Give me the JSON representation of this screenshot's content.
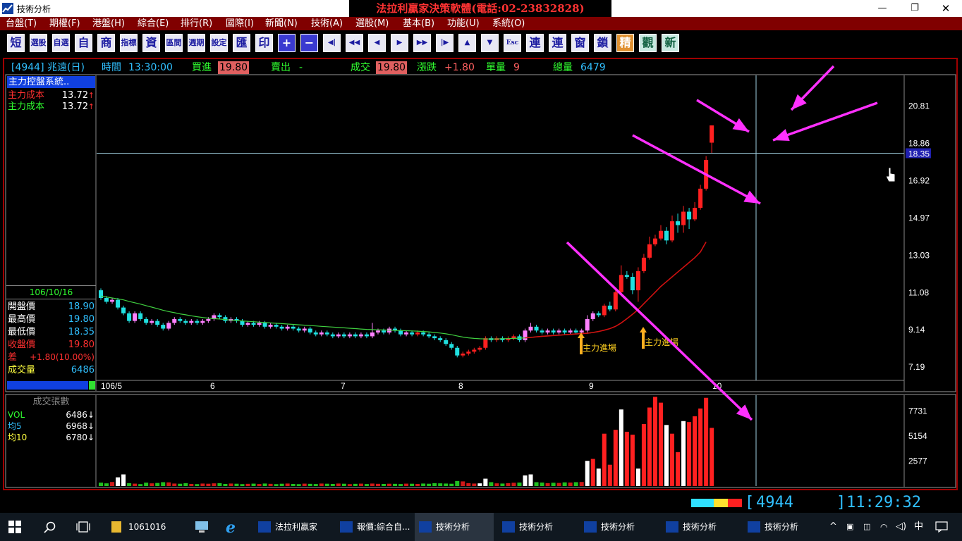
{
  "window": {
    "title": "技術分析",
    "brand": "法拉利贏家決策軟體(電話:02-23832828)"
  },
  "menu": [
    "台盤(T)",
    "期權(F)",
    "港盤(H)",
    "綜合(E)",
    "排行(R)",
    "國際(I)",
    "新聞(N)",
    "技術(A)",
    "選股(M)",
    "基本(B)",
    "功能(U)",
    "系統(O)"
  ],
  "toolbar": [
    "短",
    "選股",
    "自選",
    "自",
    "商",
    "指標",
    "資",
    "區間",
    "週期",
    "設定",
    "匯",
    "印",
    "+",
    "−",
    "◀|",
    "◀◀",
    "◀",
    "▶",
    "▶▶",
    "|▶",
    "▲",
    "▼",
    "Esc",
    "連",
    "連",
    "窗",
    "鎖",
    "精",
    "觀",
    "新"
  ],
  "quote": {
    "stock": "[4944] 兆遠(日)",
    "time_label": "時間",
    "time": "13:30:00",
    "bid_label": "買進",
    "bid": "19.80",
    "ask_label": "賣出",
    "ask": "-",
    "deal_label": "成交",
    "deal": "19.80",
    "change_label": "漲跌",
    "change": "+1.80",
    "unit_label": "單量",
    "unit": "9",
    "total_label": "總量",
    "total": "6479"
  },
  "left_panel": {
    "system": "主力控盤系統..",
    "cost_rows": [
      {
        "label": "主力成本",
        "value": "13.72",
        "arrow": "↑",
        "color": "#ff3030"
      },
      {
        "label": "主力成本",
        "value": "13.72",
        "arrow": "↑",
        "color": "#30ff30"
      }
    ],
    "date": "106/10/16",
    "stats": [
      {
        "label": "開盤價",
        "value": "18.90",
        "lc": "#ffffff",
        "vc": "#30c0ff"
      },
      {
        "label": "最高價",
        "value": "19.80",
        "lc": "#ffffff",
        "vc": "#30c0ff"
      },
      {
        "label": "最低價",
        "value": "18.35",
        "lc": "#ffffff",
        "vc": "#30c0ff"
      },
      {
        "label": "收盤價",
        "value": "19.80",
        "lc": "#ff3030",
        "vc": "#ff3030"
      },
      {
        "label": "差",
        "value": "+1.80(10.00%)",
        "lc": "#ff3030",
        "vc": "#ff3030"
      },
      {
        "label": "成交量",
        "value": "6486",
        "lc": "#ffff40",
        "vc": "#30c0ff"
      }
    ]
  },
  "vol_panel": {
    "title": "成交張數",
    "rows": [
      {
        "label": "VOL",
        "value": "6486↓",
        "lc": "#30ff30"
      },
      {
        "label": "均5",
        "value": "6968↓",
        "lc": "#30c0ff"
      },
      {
        "label": "均10",
        "value": "6780↓",
        "lc": "#ffff40"
      }
    ]
  },
  "chart_data": {
    "type": "candlestick",
    "price_axis_ticks": [
      "20.81",
      "18.86",
      "16.92",
      "14.97",
      "13.03",
      "11.08",
      "9.14",
      "7.19"
    ],
    "price_ylim": [
      6.5,
      22.3
    ],
    "crosshair_price": "18.35",
    "x_tick_labels": [
      "106/5",
      "6",
      "7",
      "8",
      "9",
      "10"
    ],
    "volume_axis_ticks": [
      "7731",
      "5154",
      "2577"
    ],
    "volume_ylim": [
      0,
      9300
    ],
    "annotations": [
      "主力進場",
      "主力進場"
    ],
    "candles": [
      [
        11.2,
        10.8,
        11.3,
        10.7
      ],
      [
        10.8,
        10.6,
        10.9,
        10.5
      ],
      [
        10.6,
        10.7,
        10.8,
        10.5
      ],
      [
        10.7,
        10.3,
        10.8,
        10.2
      ],
      [
        10.3,
        10.0,
        10.4,
        9.9
      ],
      [
        10.0,
        9.6,
        10.1,
        9.5
      ],
      [
        9.6,
        10.0,
        10.1,
        9.5
      ],
      [
        10.0,
        9.7,
        10.1,
        9.6
      ],
      [
        9.7,
        9.5,
        9.8,
        9.4
      ],
      [
        9.5,
        9.6,
        9.7,
        9.4
      ],
      [
        9.6,
        9.4,
        9.7,
        9.3
      ],
      [
        9.4,
        9.2,
        9.5,
        9.1
      ],
      [
        9.2,
        9.5,
        9.6,
        9.1
      ],
      [
        9.5,
        9.7,
        9.8,
        9.4
      ],
      [
        9.7,
        9.6,
        9.8,
        9.5
      ],
      [
        9.6,
        9.5,
        9.7,
        9.4
      ],
      [
        9.5,
        9.6,
        9.7,
        9.4
      ],
      [
        9.6,
        9.5,
        9.7,
        9.4
      ],
      [
        9.5,
        9.6,
        9.7,
        9.4
      ],
      [
        9.6,
        9.7,
        9.8,
        9.5
      ],
      [
        9.7,
        9.9,
        10.0,
        9.6
      ],
      [
        9.9,
        9.8,
        10.0,
        9.7
      ],
      [
        9.8,
        9.6,
        9.9,
        9.5
      ],
      [
        9.6,
        9.7,
        9.8,
        9.5
      ],
      [
        9.7,
        9.6,
        9.8,
        9.5
      ],
      [
        9.6,
        9.4,
        9.7,
        9.3
      ],
      [
        9.4,
        9.5,
        9.6,
        9.3
      ],
      [
        9.5,
        9.4,
        9.6,
        9.3
      ],
      [
        9.4,
        9.5,
        9.6,
        9.3
      ],
      [
        9.5,
        9.3,
        9.6,
        9.2
      ],
      [
        9.3,
        9.4,
        9.5,
        9.2
      ],
      [
        9.4,
        9.3,
        9.5,
        9.2
      ],
      [
        9.3,
        9.2,
        9.4,
        9.1
      ],
      [
        9.2,
        9.3,
        9.4,
        9.1
      ],
      [
        9.3,
        9.2,
        9.4,
        9.1
      ],
      [
        9.2,
        9.1,
        9.3,
        9.0
      ],
      [
        9.1,
        9.2,
        9.3,
        9.0
      ],
      [
        9.2,
        9.0,
        9.3,
        8.9
      ],
      [
        9.0,
        8.9,
        9.1,
        8.8
      ],
      [
        8.9,
        9.0,
        9.1,
        8.8
      ],
      [
        9.0,
        8.9,
        9.1,
        8.8
      ],
      [
        8.9,
        8.8,
        9.0,
        8.7
      ],
      [
        8.8,
        8.9,
        9.0,
        8.7
      ],
      [
        8.9,
        8.8,
        9.0,
        8.7
      ],
      [
        8.8,
        8.9,
        9.0,
        8.7
      ],
      [
        8.9,
        8.8,
        9.0,
        8.7
      ],
      [
        8.8,
        8.9,
        9.0,
        8.7
      ],
      [
        8.9,
        8.8,
        9.0,
        8.7
      ],
      [
        8.8,
        9.0,
        9.5,
        8.7
      ],
      [
        9.0,
        9.1,
        9.2,
        8.9
      ],
      [
        9.1,
        9.0,
        9.2,
        8.9
      ],
      [
        9.0,
        9.2,
        9.3,
        8.9
      ],
      [
        9.2,
        9.1,
        9.3,
        9.0
      ],
      [
        9.1,
        8.9,
        9.2,
        8.8
      ],
      [
        8.9,
        9.0,
        9.1,
        8.8
      ],
      [
        9.0,
        8.9,
        9.1,
        8.8
      ],
      [
        8.9,
        9.0,
        9.1,
        8.8
      ],
      [
        9.0,
        8.9,
        9.1,
        8.8
      ],
      [
        8.9,
        8.8,
        9.0,
        8.7
      ],
      [
        8.8,
        8.7,
        8.9,
        8.6
      ],
      [
        8.7,
        8.6,
        8.8,
        8.5
      ],
      [
        8.6,
        8.4,
        8.7,
        8.3
      ],
      [
        8.4,
        8.2,
        8.5,
        8.1
      ],
      [
        8.2,
        7.8,
        8.3,
        7.7
      ],
      [
        7.8,
        7.9,
        8.0,
        7.7
      ],
      [
        7.9,
        8.0,
        8.1,
        7.8
      ],
      [
        8.0,
        8.1,
        8.2,
        7.9
      ],
      [
        8.1,
        8.2,
        8.3,
        8.0
      ],
      [
        8.2,
        8.7,
        8.8,
        8.1
      ],
      [
        8.7,
        8.6,
        8.8,
        8.5
      ],
      [
        8.6,
        8.7,
        8.8,
        8.5
      ],
      [
        8.7,
        8.6,
        8.8,
        8.5
      ],
      [
        8.6,
        8.7,
        8.8,
        8.5
      ],
      [
        8.7,
        8.8,
        8.9,
        8.6
      ],
      [
        8.8,
        8.6,
        8.9,
        8.5
      ],
      [
        8.6,
        9.1,
        9.2,
        8.5
      ],
      [
        9.1,
        9.3,
        9.5,
        9.0
      ],
      [
        9.3,
        9.1,
        9.4,
        9.0
      ],
      [
        9.1,
        9.0,
        9.2,
        8.9
      ],
      [
        9.0,
        9.1,
        9.2,
        8.9
      ],
      [
        9.1,
        9.0,
        9.2,
        8.9
      ],
      [
        9.0,
        9.1,
        9.2,
        8.9
      ],
      [
        9.1,
        9.0,
        9.2,
        8.9
      ],
      [
        9.0,
        9.1,
        9.2,
        8.9
      ],
      [
        9.1,
        9.0,
        9.2,
        8.9
      ],
      [
        9.0,
        9.1,
        9.2,
        8.9
      ],
      [
        9.1,
        9.7,
        9.9,
        9.0
      ],
      [
        9.7,
        10.0,
        10.1,
        9.6
      ],
      [
        10.0,
        9.9,
        10.1,
        9.8
      ],
      [
        9.9,
        10.4,
        10.5,
        9.8
      ],
      [
        10.4,
        10.2,
        10.6,
        10.1
      ],
      [
        10.2,
        11.1,
        11.2,
        10.1
      ],
      [
        11.1,
        12.0,
        12.5,
        11.0
      ],
      [
        12.0,
        11.9,
        12.2,
        11.8
      ],
      [
        11.9,
        11.2,
        12.1,
        11.0
      ],
      [
        11.2,
        12.2,
        12.4,
        10.6
      ],
      [
        12.2,
        12.9,
        13.1,
        12.1
      ],
      [
        12.9,
        13.6,
        14.0,
        12.8
      ],
      [
        13.6,
        13.9,
        14.1,
        13.5
      ],
      [
        13.9,
        14.3,
        14.6,
        13.8
      ],
      [
        14.3,
        13.8,
        14.5,
        13.6
      ],
      [
        13.8,
        14.8,
        15.1,
        13.7
      ],
      [
        14.8,
        14.6,
        15.2,
        14.2
      ],
      [
        14.6,
        15.3,
        15.6,
        14.2
      ],
      [
        15.3,
        14.9,
        15.5,
        14.4
      ],
      [
        14.9,
        15.5,
        15.8,
        14.8
      ],
      [
        15.5,
        16.5,
        16.7,
        15.4
      ],
      [
        16.5,
        18.0,
        18.2,
        16.4
      ],
      [
        18.9,
        19.8,
        19.8,
        18.35
      ]
    ],
    "ma_line": [
      10.9,
      10.85,
      10.8,
      10.75,
      10.7,
      10.62,
      10.55,
      10.48,
      10.4,
      10.32,
      10.24,
      10.16,
      10.09,
      10.03,
      9.97,
      9.92,
      9.87,
      9.82,
      9.78,
      9.75,
      9.72,
      9.7,
      9.67,
      9.65,
      9.63,
      9.6,
      9.58,
      9.56,
      9.54,
      9.52,
      9.5,
      9.48,
      9.46,
      9.44,
      9.42,
      9.4,
      9.38,
      9.36,
      9.34,
      9.32,
      9.3,
      9.28,
      9.26,
      9.24,
      9.22,
      9.2,
      9.18,
      9.16,
      9.15,
      9.14,
      9.13,
      9.12,
      9.11,
      9.1,
      9.09,
      9.08,
      9.07,
      9.05,
      9.03,
      9.0,
      8.97,
      8.93,
      8.88,
      8.82,
      8.76,
      8.72,
      8.69,
      8.67,
      8.66,
      8.66,
      8.66,
      8.67,
      8.68,
      8.69,
      8.7,
      8.72,
      8.74,
      8.77,
      8.8,
      8.82,
      8.84,
      8.86,
      8.88,
      8.9,
      8.92,
      8.94,
      8.96,
      9.0,
      9.05,
      9.12,
      9.2,
      9.32,
      9.5,
      9.72,
      9.95,
      10.2,
      10.5,
      10.8,
      11.1,
      11.4,
      11.65,
      11.9,
      12.15,
      12.4,
      12.65,
      12.9,
      13.2,
      13.72
    ],
    "volumes": [
      350,
      280,
      420,
      900,
      1200,
      300,
      250,
      200,
      350,
      280,
      320,
      400,
      380,
      260,
      240,
      300,
      220,
      200,
      260,
      240,
      280,
      300,
      220,
      260,
      240,
      200,
      230,
      250,
      210,
      260,
      230,
      200,
      240,
      260,
      220,
      200,
      250,
      230,
      210,
      260,
      240,
      220,
      260,
      240,
      200,
      230,
      250,
      210,
      260,
      230,
      220,
      240,
      230,
      210,
      250,
      240,
      220,
      260,
      240,
      300,
      280,
      260,
      240,
      520,
      480,
      300,
      260,
      280,
      760,
      400,
      280,
      260,
      300,
      340,
      360,
      1100,
      1200,
      400,
      360,
      300,
      340,
      320,
      380,
      360,
      400,
      420,
      2600,
      2800,
      1800,
      5400,
      2200,
      5800,
      7900,
      5600,
      5300,
      1800,
      6400,
      8100,
      9200,
      8600,
      6300,
      5400,
      3500,
      6700,
      6600,
      7200,
      8000,
      9100,
      6000
    ],
    "volume_white": [
      3,
      4,
      67,
      68,
      75,
      76,
      86,
      88,
      92,
      95,
      100,
      103
    ]
  },
  "status": {
    "code": "4944",
    "clock": "11:29:32"
  },
  "taskbar": {
    "folder": "1061016",
    "apps": [
      "法拉利贏家",
      "報價:綜合自...",
      "技術分析",
      "技術分析",
      "技術分析",
      "技術分析",
      "技術分析"
    ],
    "ime": "中"
  },
  "colors": {
    "up": "#ff2020",
    "down": "#20e0e0",
    "flat": "#ff80ff",
    "ma": "#40d040",
    "cost": "#d01010",
    "arrow": "#ff30ff"
  }
}
